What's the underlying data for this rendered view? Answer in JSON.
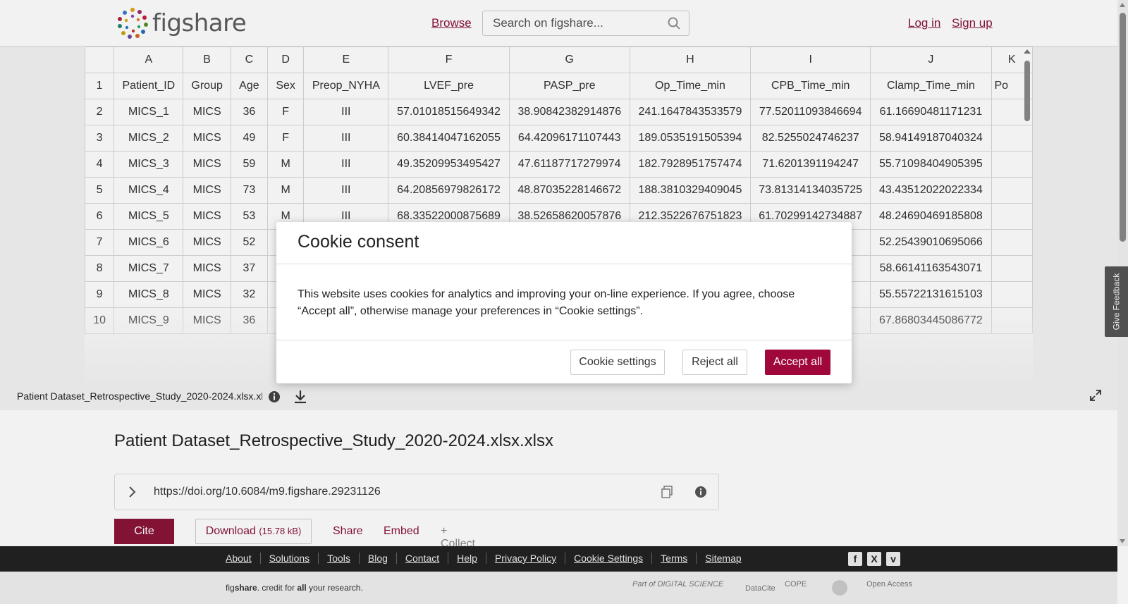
{
  "header": {
    "logo_text": "figshare",
    "browse": "Browse",
    "search_placeholder": "Search on figshare...",
    "login": "Log in",
    "signup": "Sign up"
  },
  "sheet": {
    "col_letters": [
      "",
      "A",
      "B",
      "C",
      "D",
      "E",
      "F",
      "G",
      "H",
      "I",
      "J",
      "K"
    ],
    "rows": [
      [
        "1",
        "Patient_ID",
        "Group",
        "Age",
        "Sex",
        "Preop_NYHA",
        "LVEF_pre",
        "PASP_pre",
        "Op_Time_min",
        "CPB_Time_min",
        "Clamp_Time_min",
        "Po"
      ],
      [
        "2",
        "MICS_1",
        "MICS",
        "36",
        "F",
        "III",
        "57.01018515649342",
        "38.90842382914876",
        "241.1647843533579",
        "77.52011093846694",
        "61.16690481171231",
        ""
      ],
      [
        "3",
        "MICS_2",
        "MICS",
        "49",
        "F",
        "III",
        "60.38414047162055",
        "64.42096171107443",
        "189.0535191505394",
        "82.5255024746237",
        "58.94149187040324",
        ""
      ],
      [
        "4",
        "MICS_3",
        "MICS",
        "59",
        "M",
        "III",
        "49.35209953495427",
        "47.61187717279974",
        "182.7928951757474",
        "71.6201391194247",
        "55.71098404905395",
        ""
      ],
      [
        "5",
        "MICS_4",
        "MICS",
        "73",
        "M",
        "III",
        "64.20856979826172",
        "48.87035228146672",
        "188.3810329409045",
        "73.81314134035725",
        "43.43512022022334",
        ""
      ],
      [
        "6",
        "MICS_5",
        "MICS",
        "53",
        "M",
        "III",
        "68.33522000875689",
        "38.52658620057876",
        "212.3522676751823",
        "61.70299142734887",
        "48.24690469185808",
        ""
      ],
      [
        "7",
        "MICS_6",
        "MICS",
        "52",
        "",
        "",
        "",
        "",
        "",
        "325",
        "52.25439010695066",
        ""
      ],
      [
        "8",
        "MICS_7",
        "MICS",
        "37",
        "",
        "",
        "",
        "",
        "",
        "074",
        "58.66141163543071",
        ""
      ],
      [
        "9",
        "MICS_8",
        "MICS",
        "32",
        "",
        "",
        "",
        "",
        "",
        "516",
        "55.55722131615103",
        ""
      ],
      [
        "10",
        "MICS_9",
        "MICS",
        "36",
        "",
        "",
        "",
        "",
        "",
        "218",
        "67.86803445086772",
        ""
      ]
    ]
  },
  "filebar": {
    "filename": "Patient Dataset_Retrospective_Study_2020-2024.xlsx.xlsx"
  },
  "details": {
    "title": "Patient Dataset_Retrospective_Study_2020-2024.xlsx.xlsx",
    "doi": "https://doi.org/10.6084/m9.figshare.29231126",
    "cite": "Cite",
    "download": "Download",
    "download_size": "(15.78 kB)",
    "share": "Share",
    "embed": "Embed",
    "collect": "+ Collect"
  },
  "footer": {
    "links": [
      "About",
      "Solutions",
      "Tools",
      "Blog",
      "Contact",
      "Help",
      "Privacy Policy",
      "Cookie Settings",
      "Terms",
      "Sitemap"
    ],
    "tagline_fig": "fig",
    "tagline_share": "share",
    "tagline_mid": ". credit for ",
    "tagline_all": "all",
    "tagline_end": " your research.",
    "partners": [
      "Part of DIGITAL SCIENCE",
      "DataCite",
      "COPE",
      "Open Access"
    ]
  },
  "feedback": "Give Feedback",
  "cookie": {
    "title": "Cookie consent",
    "body": "This website uses cookies for analytics and improving your on-line experience. If you agree, choose “Accept all”, otherwise manage your preferences in “Cookie settings”.",
    "settings": "Cookie settings",
    "reject": "Reject all",
    "accept": "Accept all"
  },
  "colors": {
    "brand": "#8a1538",
    "accept": "#a0083c",
    "footer_dark": "#222222"
  }
}
